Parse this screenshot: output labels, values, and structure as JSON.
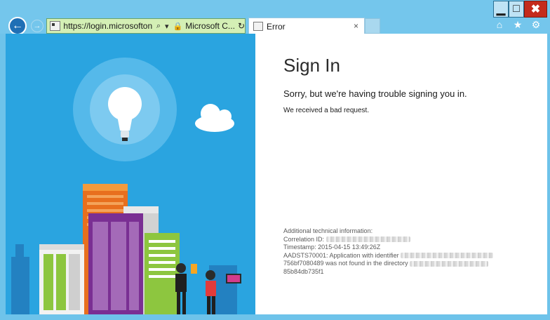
{
  "browser": {
    "address_url": "https://login.microsoftonline....",
    "search_icon": "⌕",
    "dropdown": "▾",
    "lock_icon": "🔒",
    "site_name": "Microsoft C...",
    "refresh_icon": "↻",
    "tab_title": "Error",
    "tab_close": "×",
    "min_glyph": "▁",
    "max_glyph": "□",
    "close_glyph": "✖",
    "home_glyph": "⌂",
    "star_glyph": "★",
    "gear_glyph": "⚙",
    "back_glyph": "←",
    "forward_glyph": "→"
  },
  "page": {
    "title": "Sign In",
    "message": "Sorry, but we're having trouble signing you in.",
    "submessage": "We received a bad request.",
    "tech_heading": "Additional technical information:",
    "correlation_label": "Correlation ID:",
    "timestamp": "Timestamp: 2015-04-15 13:49:26Z",
    "error_line1": "AADSTS70001: Application with identifier",
    "error_line2": "756bf7080489 was not found in the directory",
    "error_line3": "85b84db735f1"
  },
  "colors": {
    "chrome": "#74c6ec",
    "illustration_bg": "#2aa4e0",
    "back_button": "#1f6fb5",
    "close_button": "#c42b1c"
  }
}
